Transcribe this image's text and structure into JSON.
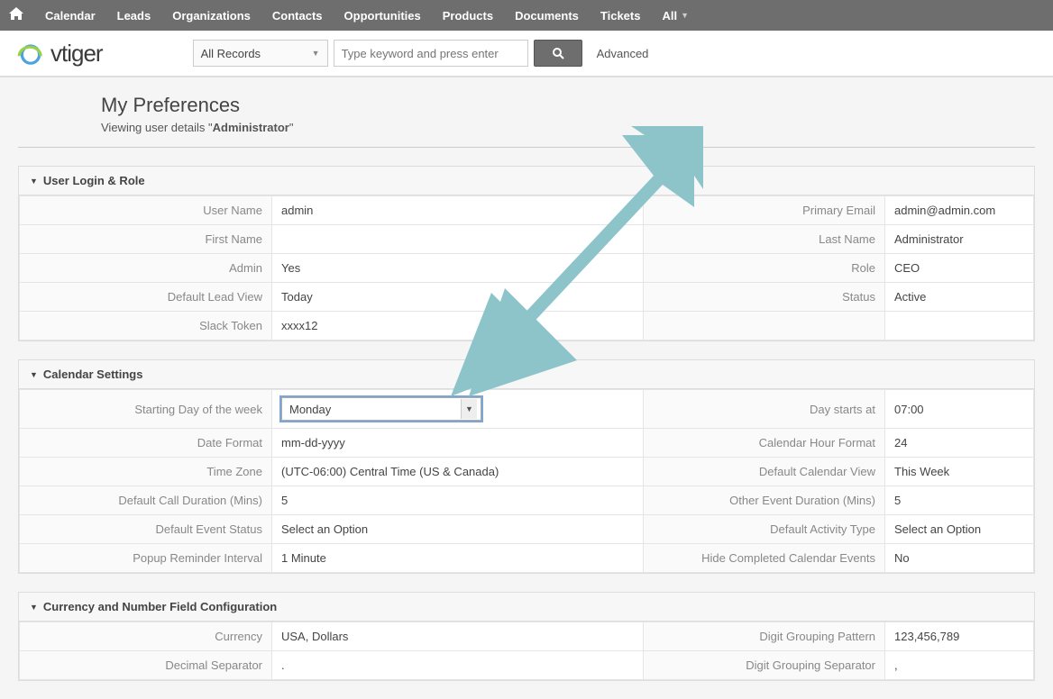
{
  "nav": {
    "items": [
      "Calendar",
      "Leads",
      "Organizations",
      "Contacts",
      "Opportunities",
      "Products",
      "Documents",
      "Tickets"
    ],
    "all_label": "All"
  },
  "logo_text": "vtiger",
  "search": {
    "records_label": "All Records",
    "placeholder": "Type keyword and press enter",
    "advanced": "Advanced"
  },
  "page": {
    "title": "My Preferences",
    "sub_prefix": "Viewing user details  \"",
    "sub_user": "Administrator",
    "sub_suffix": "\""
  },
  "sections": {
    "login": {
      "title": "User Login & Role",
      "rows": [
        {
          "l_label": "User Name",
          "l_value": "admin",
          "r_label": "Primary Email",
          "r_value": "admin@admin.com"
        },
        {
          "l_label": "First Name",
          "l_value": "",
          "r_label": "Last Name",
          "r_value": "Administrator"
        },
        {
          "l_label": "Admin",
          "l_value": "Yes",
          "r_label": "Role",
          "r_value": "CEO"
        },
        {
          "l_label": "Default Lead View",
          "l_value": "Today",
          "r_label": "Status",
          "r_value": "Active"
        },
        {
          "l_label": "Slack Token",
          "l_value": "xxxx12",
          "r_label": "",
          "r_value": ""
        }
      ]
    },
    "calendar": {
      "title": "Calendar Settings",
      "starting_day_label": "Starting Day of the week",
      "starting_day_value": "Monday",
      "rows": [
        {
          "l_label": "Date Format",
          "l_value": "mm-dd-yyyy",
          "r_label": "Calendar Hour Format",
          "r_value": "24"
        },
        {
          "l_label": "Time Zone",
          "l_value": "(UTC-06:00) Central Time (US & Canada)",
          "r_label": "Default Calendar View",
          "r_value": "This Week"
        },
        {
          "l_label": "Default Call Duration (Mins)",
          "l_value": "5",
          "r_label": "Other Event Duration (Mins)",
          "r_value": "5"
        },
        {
          "l_label": "Default Event Status",
          "l_value": "Select an Option",
          "r_label": "Default Activity Type",
          "r_value": "Select an Option"
        },
        {
          "l_label": "Popup Reminder Interval",
          "l_value": "1 Minute",
          "r_label": "Hide Completed Calendar Events",
          "r_value": "No"
        }
      ],
      "day_starts_label": "Day starts at",
      "day_starts_value": "07:00"
    },
    "currency": {
      "title": "Currency and Number Field Configuration",
      "rows": [
        {
          "l_label": "Currency",
          "l_value": "USA, Dollars",
          "r_label": "Digit Grouping Pattern",
          "r_value": "123,456,789"
        },
        {
          "l_label": "Decimal Separator",
          "l_value": ".",
          "r_label": "Digit Grouping Separator",
          "r_value": ","
        }
      ]
    }
  }
}
